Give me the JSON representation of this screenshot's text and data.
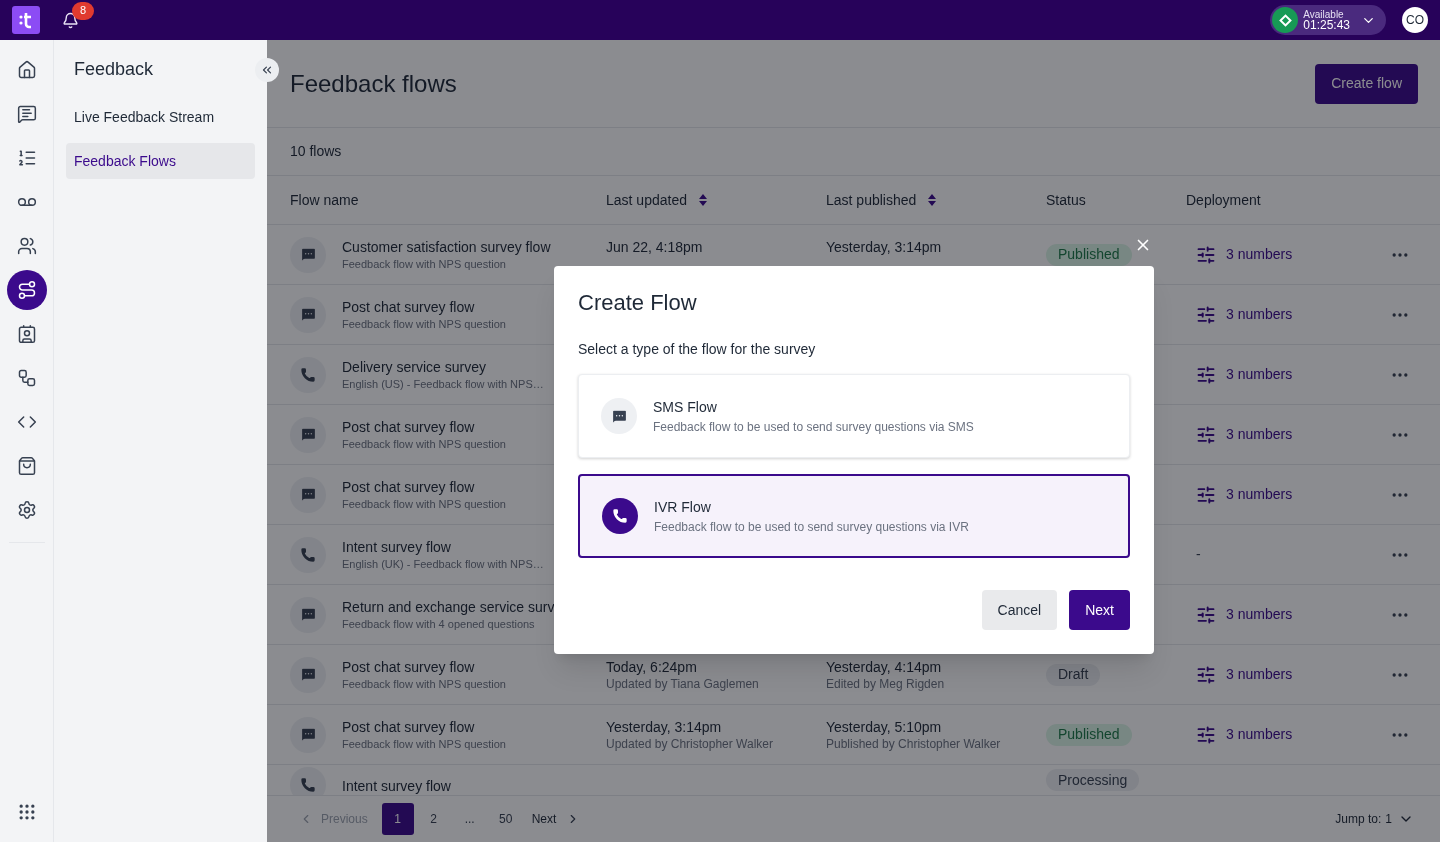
{
  "topbar": {
    "notification_count": "8",
    "presence": {
      "label": "Available",
      "timer": "01:25:43"
    },
    "avatar": "CO"
  },
  "rail": [
    {
      "selected": false
    },
    {
      "selected": false
    },
    {
      "selected": false
    },
    {
      "selected": false
    },
    {
      "selected": false
    },
    {
      "selected": true
    },
    {
      "selected": false
    },
    {
      "selected": false
    },
    {
      "selected": false
    },
    {
      "selected": false
    },
    {
      "selected": false
    }
  ],
  "subnav": {
    "title": "Feedback",
    "items": [
      {
        "label": "Live Feedback Stream",
        "selected": false
      },
      {
        "label": "Feedback Flows",
        "selected": true
      }
    ]
  },
  "page": {
    "title": "Feedback flows",
    "create_button": "Create flow",
    "count": "10 flows"
  },
  "table": {
    "columns": [
      {
        "label": "Flow name",
        "sortable": false
      },
      {
        "label": "Last updated",
        "sortable": true
      },
      {
        "label": "Last published",
        "sortable": true
      },
      {
        "label": "Status",
        "sortable": false
      },
      {
        "label": "Deployment",
        "sortable": false
      }
    ],
    "rows": [
      {
        "kind": "sms",
        "name": "Customer satisfaction survey flow",
        "description": "Feedback flow with NPS question",
        "last_updated": {
          "time": "Jun 22, 4:18pm"
        },
        "last_published": {
          "time": "Yesterday, 3:14pm"
        },
        "status": {
          "label": "Published",
          "kind": "published"
        },
        "deployment": {
          "label": "3 numbers",
          "kind": "numbers"
        }
      },
      {
        "kind": "sms",
        "name": "Post chat survey flow",
        "description": "Feedback flow with NPS question",
        "deployment": {
          "label": "3 numbers",
          "kind": "numbers"
        }
      },
      {
        "kind": "ivr",
        "name": "Delivery service survey",
        "description": "English (US) - Feedback flow with NPS…",
        "deployment": {
          "label": "3 numbers",
          "kind": "numbers"
        }
      },
      {
        "kind": "sms",
        "name": "Post chat survey flow",
        "description": "Feedback flow with NPS question",
        "deployment": {
          "label": "3 numbers",
          "kind": "numbers"
        }
      },
      {
        "kind": "sms",
        "name": "Post chat survey flow",
        "description": "Feedback flow with NPS question",
        "deployment": {
          "label": "3 numbers",
          "kind": "numbers"
        }
      },
      {
        "kind": "ivr",
        "name": "Intent survey flow",
        "description": "English (UK) - Feedback flow with NPS…",
        "deployment": {
          "label": "-",
          "kind": "none"
        }
      },
      {
        "kind": "sms",
        "name": "Return and exchange service surv",
        "description": "Feedback flow with 4 opened questions",
        "deployment": {
          "label": "3 numbers",
          "kind": "numbers"
        }
      },
      {
        "kind": "sms",
        "name": "Post chat survey flow",
        "description": "Feedback flow with NPS question",
        "last_updated": {
          "time": "Today, 6:24pm",
          "by": "Updated by Tiana Gaglemen"
        },
        "last_published": {
          "time": "Yesterday, 4:14pm",
          "by": "Edited by Meg Rigden"
        },
        "status": {
          "label": "Draft",
          "kind": "draft"
        },
        "deployment": {
          "label": "3 numbers",
          "kind": "numbers"
        }
      },
      {
        "kind": "sms",
        "name": "Post chat survey flow",
        "description": "Feedback flow with NPS question",
        "last_updated": {
          "time": "Yesterday, 3:14pm",
          "by": "Updated by Christopher Walker"
        },
        "last_published": {
          "time": "Yesterday, 5:10pm",
          "by": "Published by Christopher Walker"
        },
        "status": {
          "label": "Published",
          "kind": "published"
        },
        "deployment": {
          "label": "3 numbers",
          "kind": "numbers"
        }
      },
      {
        "kind": "ivr",
        "name": "Intent survey flow",
        "status": {
          "label": "Processing",
          "kind": "processing"
        }
      }
    ]
  },
  "pagination": {
    "previous": "Previous",
    "pages": [
      {
        "label": "1",
        "selected": true
      },
      {
        "label": "2",
        "selected": false
      },
      {
        "label": "...",
        "selected": false
      },
      {
        "label": "50",
        "selected": false
      }
    ],
    "next": "Next",
    "jump_label": "Jump to:",
    "jump_value": "1"
  },
  "modal": {
    "title": "Create Flow",
    "prompt": "Select a type of the flow for the survey",
    "options": [
      {
        "kind": "sms",
        "title": "SMS Flow",
        "description": "Feedback flow to be used to send survey questions via SMS",
        "selected": false
      },
      {
        "kind": "ivr",
        "title": "IVR Flow",
        "description": "Feedback flow to be used to send survey questions via IVR",
        "selected": true
      }
    ],
    "cancel": "Cancel",
    "next": "Next"
  }
}
